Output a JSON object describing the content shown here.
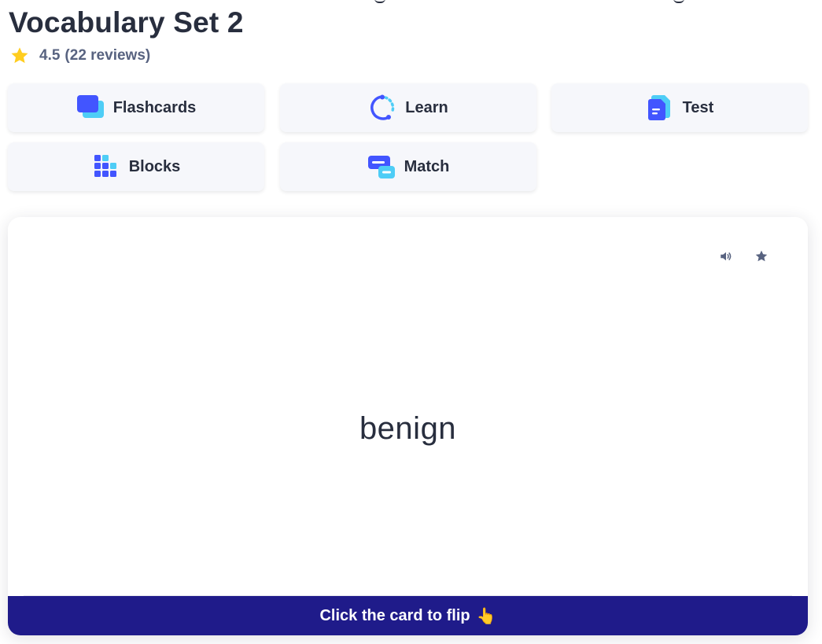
{
  "set": {
    "title": "Vocabulary Set 2",
    "rating": "4.5",
    "reviews": "(22 reviews)"
  },
  "modes": {
    "flashcards": "Flashcards",
    "learn": "Learn",
    "test": "Test",
    "blocks": "Blocks",
    "match": "Match"
  },
  "card": {
    "term": "benign",
    "flip_hint": "Click the card to flip",
    "flip_emoji": "👆",
    "audio_icon": "speaker-icon",
    "star_icon": "star-icon"
  },
  "colors": {
    "text": "#282e3e",
    "muted": "#586380",
    "star": "#ffcd1f",
    "button_bg": "#f6f7fb",
    "accent_blue": "#4255ff",
    "accent_cyan": "#4ecdf6",
    "footer_bg": "#1f1b8a"
  }
}
